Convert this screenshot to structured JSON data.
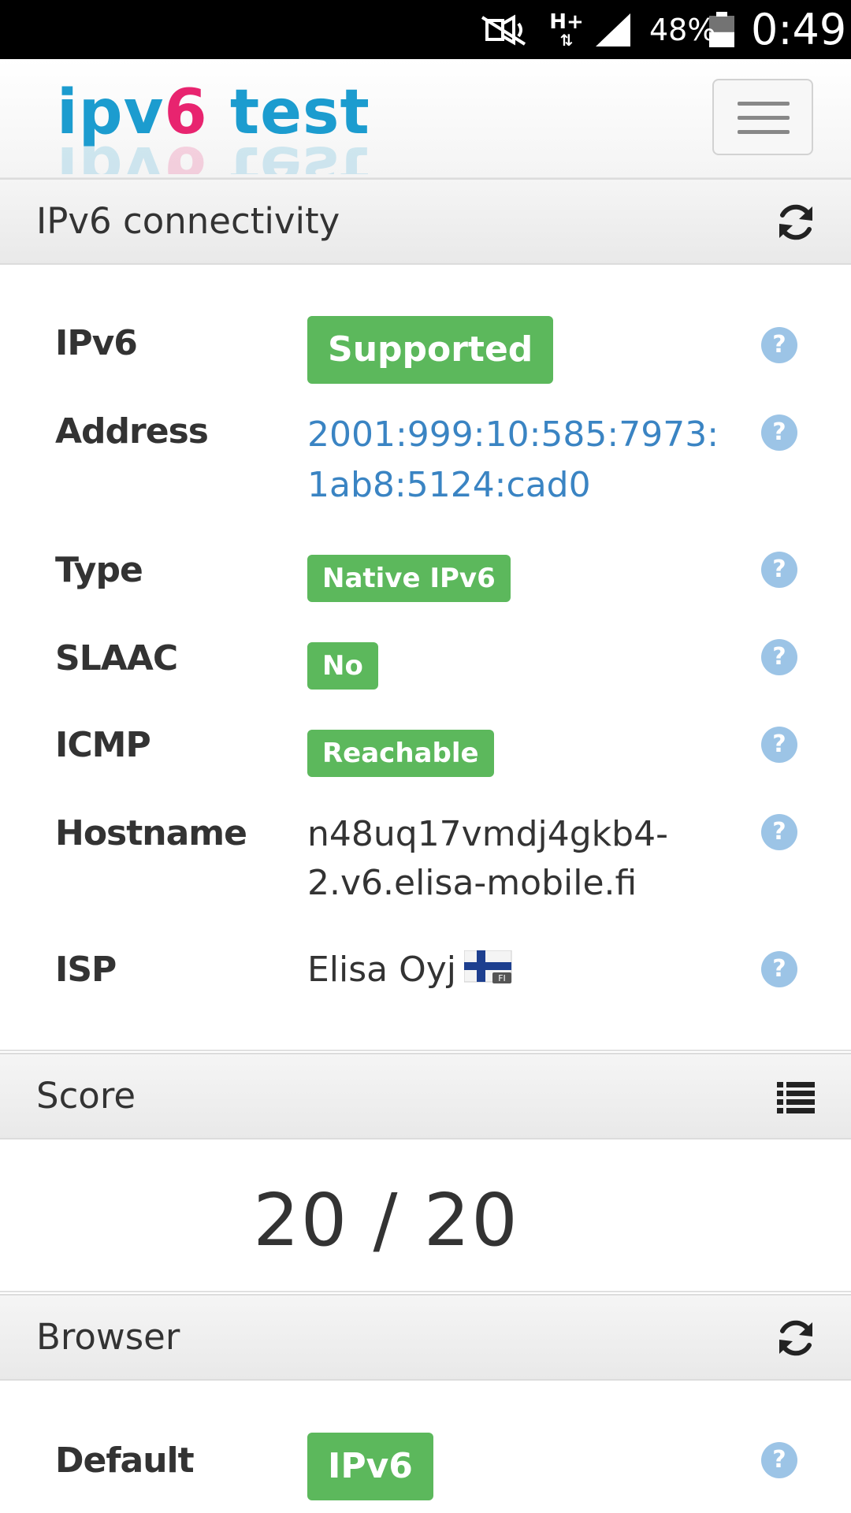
{
  "status_bar": {
    "network_type": "H+",
    "battery_percent": "48%",
    "battery_level": 0.48,
    "time": "0:49"
  },
  "header": {
    "logo": {
      "part1": "ipv",
      "part2": "6",
      "part3": " test"
    },
    "menu_icon": "hamburger-menu-icon"
  },
  "connectivity": {
    "title": "IPv6 connectivity",
    "icon": "refresh-icon",
    "rows": [
      {
        "label": "IPv6",
        "value": "Supported",
        "style": "badge-large"
      },
      {
        "label": "Address",
        "line1": "2001:999:10:585:7973:",
        "line2": "1ab8:5124:cad0",
        "style": "link"
      },
      {
        "label": "Type",
        "value": "Native IPv6",
        "style": "badge"
      },
      {
        "label": "SLAAC",
        "value": "No",
        "style": "badge"
      },
      {
        "label": "ICMP",
        "value": "Reachable",
        "style": "badge"
      },
      {
        "label": "Hostname",
        "line1": "n48uq17vmdj4gkb4-",
        "line2": "2.v6.elisa-mobile.fi",
        "style": "text"
      },
      {
        "label": "ISP",
        "value": "Elisa Oyj",
        "flag_code": "FI",
        "style": "text"
      }
    ],
    "help_glyph": "?"
  },
  "score": {
    "title": "Score",
    "icon": "list-icon",
    "value": "20 / 20"
  },
  "browser": {
    "title": "Browser",
    "icon": "refresh-icon",
    "rows": [
      {
        "label": "Default",
        "value": "IPv6",
        "style": "badge-large"
      }
    ]
  },
  "colors": {
    "badge_green": "#5cb85c",
    "link_blue": "#3a84c3",
    "help_blue": "#9cc4e6",
    "logo_blue": "#1c9ccf",
    "logo_pink": "#e8246f"
  }
}
